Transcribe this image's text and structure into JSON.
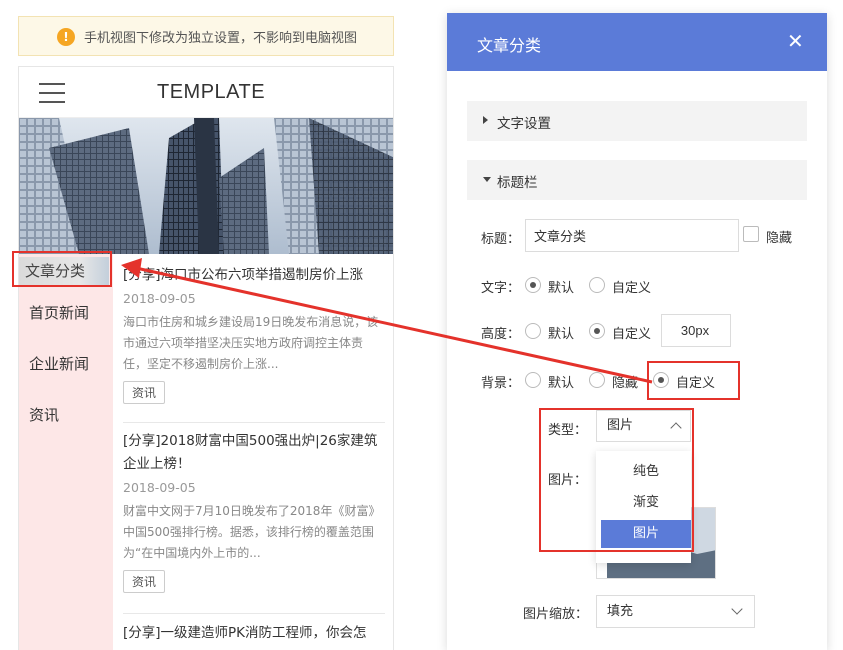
{
  "notice": {
    "text": "手机视图下修改为独立设置，不影响到电脑视图",
    "icon": "info-icon"
  },
  "preview": {
    "brand": "TEMPLATE",
    "menu_icon": "hamburger-icon",
    "sidebar": {
      "items": [
        "文章分类",
        "首页新闻",
        "企业新闻",
        "资讯"
      ]
    },
    "articles": [
      {
        "title": "[分享]海口市公布六项举措遏制房价上涨",
        "date": "2018-09-05",
        "summary": "海口市住房和城乡建设局19日晚发布消息说，该市通过六项举措坚决压实地方政府调控主体责任，坚定不移遏制房价上涨...",
        "tag": "资讯"
      },
      {
        "title": "[分享]2018财富中国500强出炉|26家建筑企业上榜！",
        "date": "2018-09-05",
        "summary": "财富中文网于7月10日晚发布了2018年《财富》中国500强排行榜。据悉，该排行榜的覆盖范围为“在中国境内外上市的...",
        "tag": "资讯"
      },
      {
        "title": "[分享]一级建造师PK消防工程师，你会怎"
      }
    ]
  },
  "dialog": {
    "title": "文章分类",
    "close_icon": "close-icon",
    "sections": {
      "text_settings": "文字设置",
      "title_bar": "标题栏"
    },
    "title_field": {
      "label": "标题：",
      "value": "文章分类",
      "hide_label": "隐藏"
    },
    "text_field": {
      "label": "文字：",
      "options": [
        "默认",
        "自定义"
      ],
      "selected": "默认"
    },
    "height_field": {
      "label": "高度：",
      "options": [
        "默认",
        "自定义"
      ],
      "selected": "自定义",
      "value": "30px"
    },
    "bg_field": {
      "label": "背景：",
      "options": [
        "默认",
        "隐藏",
        "自定义"
      ],
      "selected": "自定义"
    },
    "type_field": {
      "label": "类型：",
      "value": "图片",
      "options": [
        "纯色",
        "渐变",
        "图片"
      ],
      "selected": "图片"
    },
    "image_field": {
      "label": "图片："
    },
    "scale_field": {
      "label": "图片缩放：",
      "value": "填充"
    }
  },
  "colors": {
    "accent": "#5b7bd8",
    "annotation": "#e4322b",
    "sidebar_bg": "#fde7e7",
    "notice_bg": "#fdf8e7"
  }
}
